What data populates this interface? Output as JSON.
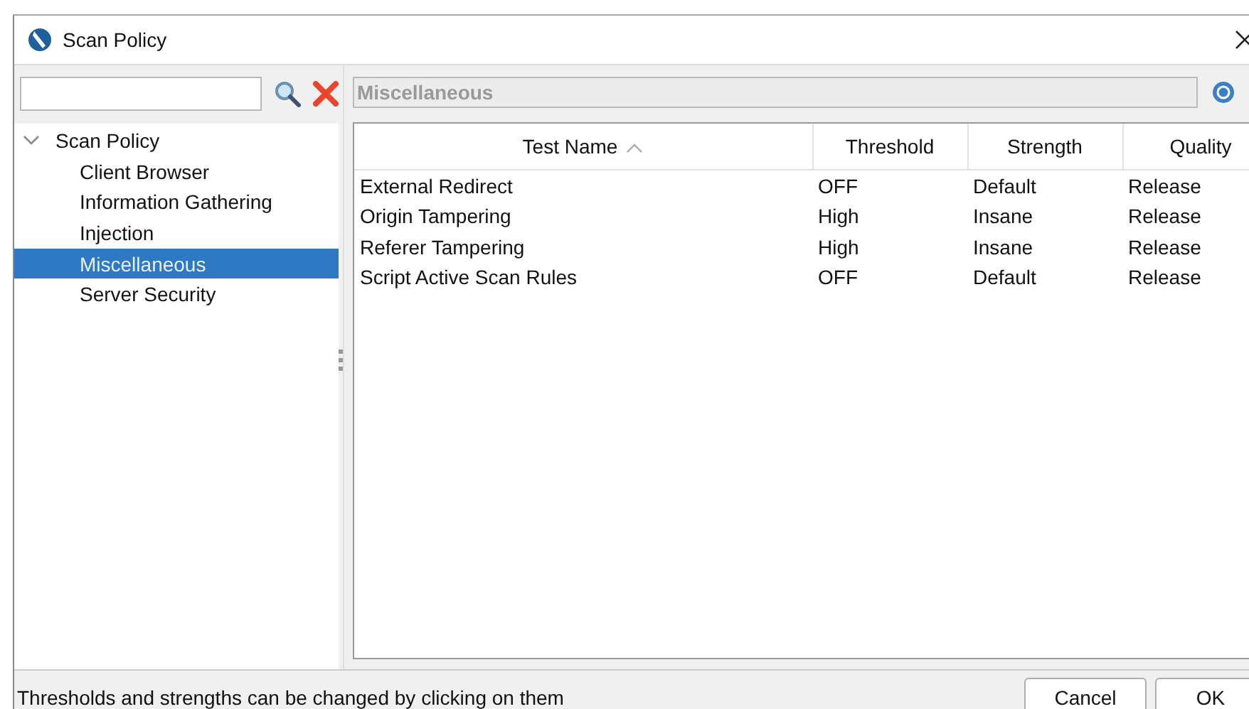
{
  "window": {
    "title": "Scan Policy"
  },
  "tree": [
    {
      "label": "Scan Policy",
      "expanded": true,
      "selected": false,
      "children": [
        {
          "label": "Client Browser",
          "selected": false
        },
        {
          "label": "Information Gathering",
          "selected": false
        },
        {
          "label": "Injection",
          "selected": false
        },
        {
          "label": "Miscellaneous",
          "selected": true
        },
        {
          "label": "Server Security",
          "selected": false
        }
      ]
    }
  ],
  "panel_title": "Miscellaneous",
  "table": {
    "columns": [
      "Test Name",
      "Threshold",
      "Strength",
      "Quality"
    ],
    "rows": [
      [
        "External Redirect",
        "OFF",
        "Default",
        "Release"
      ],
      [
        "Origin Tampering",
        "High",
        "Insane",
        "Release"
      ],
      [
        "Referer Tampering",
        "High",
        "Insane",
        "Release"
      ],
      [
        "Script Active Scan Rules",
        "OFF",
        "Default",
        "Release"
      ]
    ]
  },
  "status_bar": "Thresholds and strengths can be changed by clicking on them",
  "buttons": [
    "Cancel",
    "OK"
  ]
}
